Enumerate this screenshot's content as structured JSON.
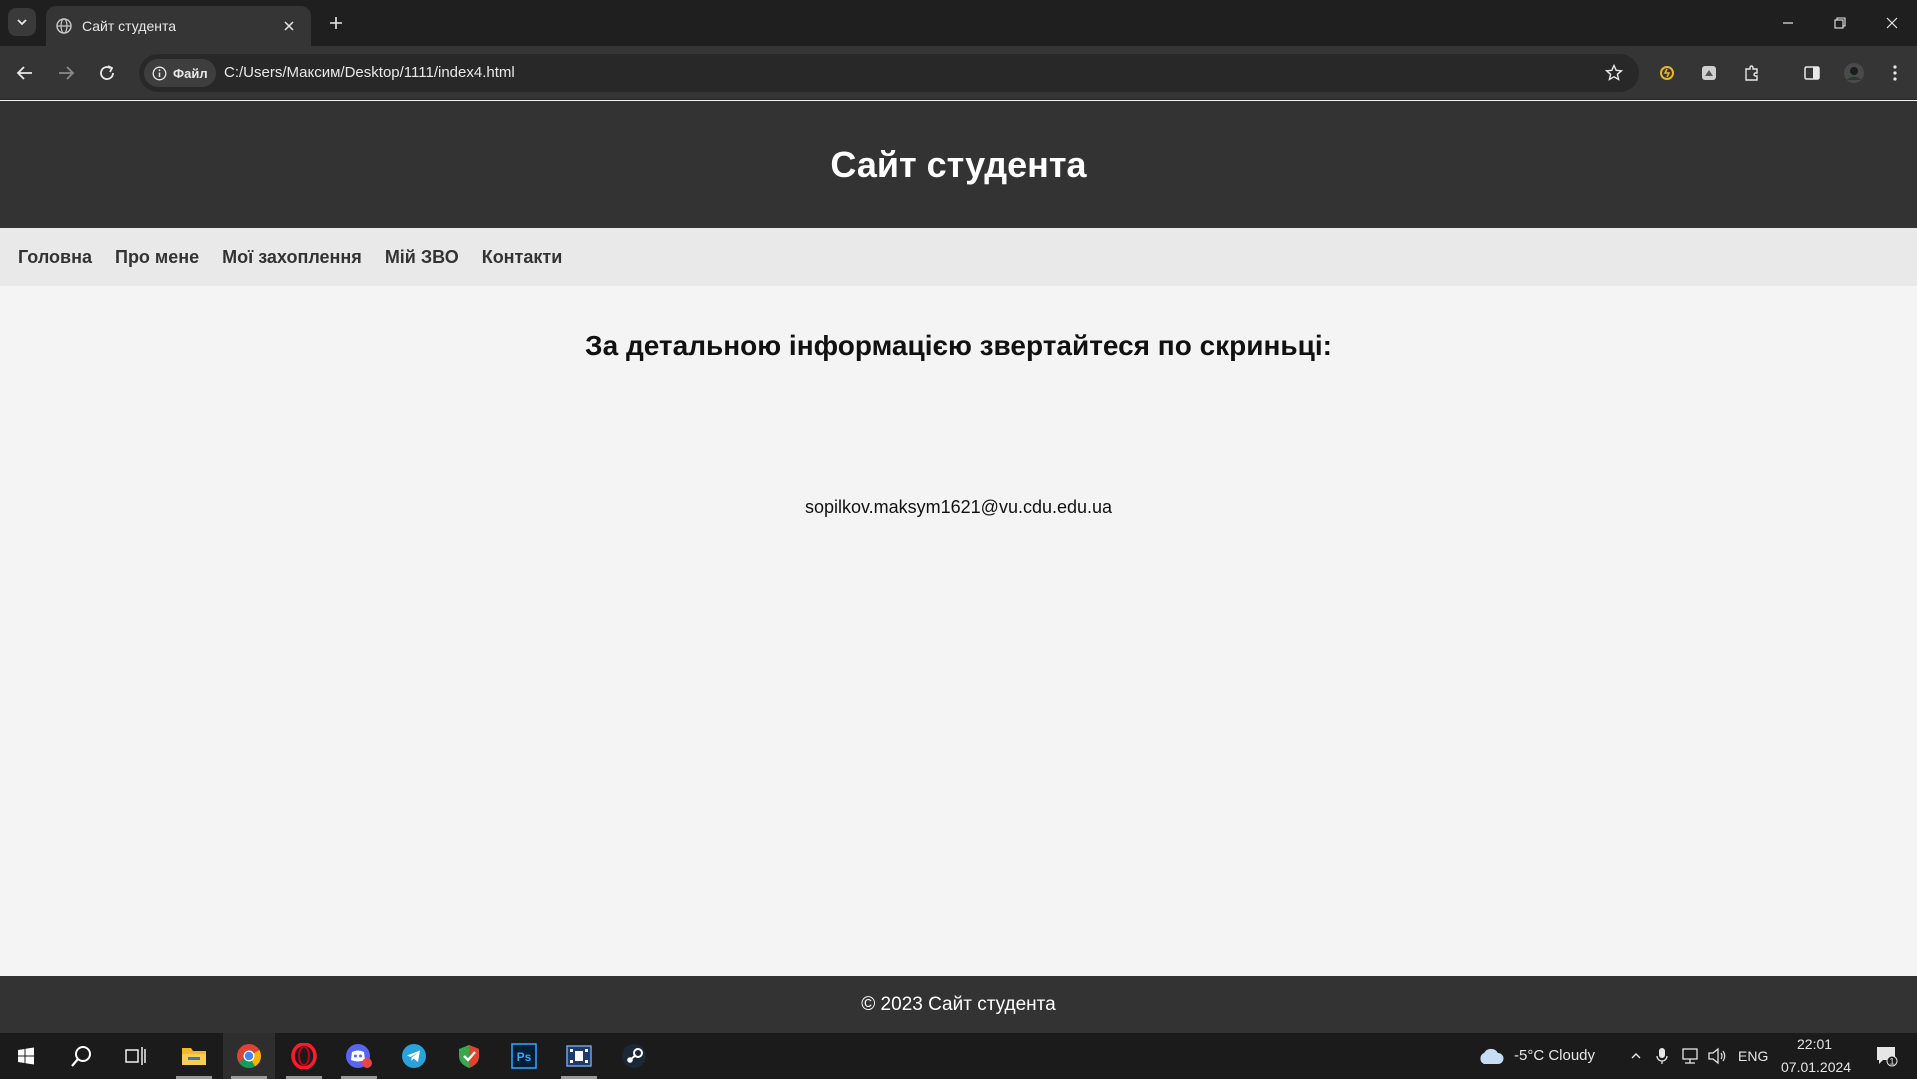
{
  "browser": {
    "tab_title": "Сайт студента",
    "chip_label": "Файл",
    "url": "C:/Users/Максим/Desktop/1111/index4.html",
    "icons": [
      "tab-search-icon",
      "globe-icon",
      "close-icon",
      "plus-icon",
      "minimize-icon",
      "restore-icon",
      "back-icon",
      "forward-icon",
      "reload-icon",
      "info-icon",
      "star-icon",
      "extension-icon",
      "puzzle-icon",
      "side-panel-icon",
      "profile-avatar",
      "menu-icon"
    ]
  },
  "page": {
    "title": "Сайт студента",
    "nav": [
      "Головна",
      "Про мене",
      "Мої захоплення",
      "Мій ЗВО",
      "Контакти"
    ],
    "heading": "За детальною інформацією звертайтеся по скриньці:",
    "email": "sopilkov.maksym1621@vu.cdu.edu.ua",
    "footer": "© 2023 Сайт студента"
  },
  "taskbar": {
    "apps": [
      "windows-start-icon",
      "search-icon",
      "task-view-icon",
      "file-explorer-icon",
      "chrome-icon",
      "opera-icon",
      "discord-icon",
      "telegram-icon",
      "vpn-icon",
      "photoshop-icon",
      "video-editor-icon",
      "steam-icon"
    ],
    "photoshop_label": "Ps",
    "weather": "-5°C  Cloudy",
    "language": "ENG",
    "time": "22:01",
    "date": "07.01.2024",
    "notification_count": "1"
  },
  "colors": {
    "header_bg": "#333333",
    "nav_bg": "#e9e9e9",
    "page_bg": "#f4f4f4",
    "footer_bg": "#333333"
  }
}
